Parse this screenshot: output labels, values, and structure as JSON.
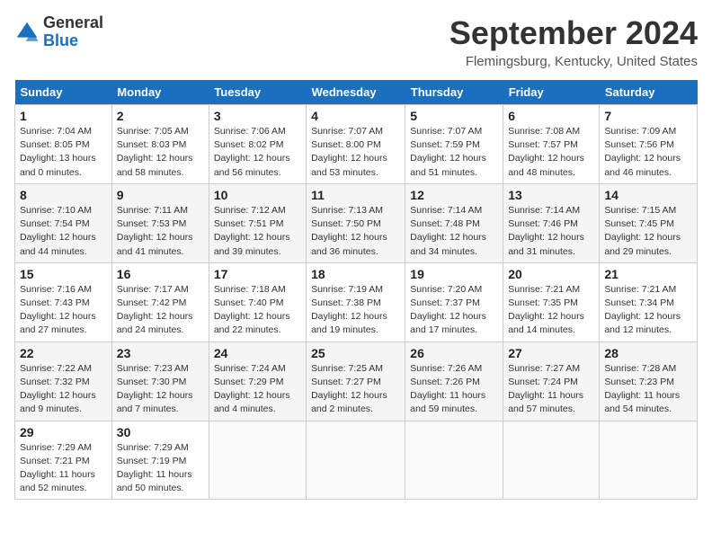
{
  "header": {
    "logo_line1": "General",
    "logo_line2": "Blue",
    "month_title": "September 2024",
    "location": "Flemingsburg, Kentucky, United States"
  },
  "calendar": {
    "days_of_week": [
      "Sunday",
      "Monday",
      "Tuesday",
      "Wednesday",
      "Thursday",
      "Friday",
      "Saturday"
    ],
    "weeks": [
      [
        {
          "num": "",
          "info": ""
        },
        {
          "num": "2",
          "info": "Sunrise: 7:05 AM\nSunset: 8:03 PM\nDaylight: 12 hours\nand 58 minutes."
        },
        {
          "num": "3",
          "info": "Sunrise: 7:06 AM\nSunset: 8:02 PM\nDaylight: 12 hours\nand 56 minutes."
        },
        {
          "num": "4",
          "info": "Sunrise: 7:07 AM\nSunset: 8:00 PM\nDaylight: 12 hours\nand 53 minutes."
        },
        {
          "num": "5",
          "info": "Sunrise: 7:07 AM\nSunset: 7:59 PM\nDaylight: 12 hours\nand 51 minutes."
        },
        {
          "num": "6",
          "info": "Sunrise: 7:08 AM\nSunset: 7:57 PM\nDaylight: 12 hours\nand 48 minutes."
        },
        {
          "num": "7",
          "info": "Sunrise: 7:09 AM\nSunset: 7:56 PM\nDaylight: 12 hours\nand 46 minutes."
        }
      ],
      [
        {
          "num": "1",
          "info": "Sunrise: 7:04 AM\nSunset: 8:05 PM\nDaylight: 13 hours\nand 0 minutes."
        },
        {
          "num": "8",
          "info": "Sunrise: 7:10 AM\nSunset: 7:54 PM\nDaylight: 12 hours\nand 44 minutes."
        },
        {
          "num": "9",
          "info": "Sunrise: 7:11 AM\nSunset: 7:53 PM\nDaylight: 12 hours\nand 41 minutes."
        },
        {
          "num": "10",
          "info": "Sunrise: 7:12 AM\nSunset: 7:51 PM\nDaylight: 12 hours\nand 39 minutes."
        },
        {
          "num": "11",
          "info": "Sunrise: 7:13 AM\nSunset: 7:50 PM\nDaylight: 12 hours\nand 36 minutes."
        },
        {
          "num": "12",
          "info": "Sunrise: 7:14 AM\nSunset: 7:48 PM\nDaylight: 12 hours\nand 34 minutes."
        },
        {
          "num": "13",
          "info": "Sunrise: 7:14 AM\nSunset: 7:46 PM\nDaylight: 12 hours\nand 31 minutes."
        },
        {
          "num": "14",
          "info": "Sunrise: 7:15 AM\nSunset: 7:45 PM\nDaylight: 12 hours\nand 29 minutes."
        }
      ],
      [
        {
          "num": "15",
          "info": "Sunrise: 7:16 AM\nSunset: 7:43 PM\nDaylight: 12 hours\nand 27 minutes."
        },
        {
          "num": "16",
          "info": "Sunrise: 7:17 AM\nSunset: 7:42 PM\nDaylight: 12 hours\nand 24 minutes."
        },
        {
          "num": "17",
          "info": "Sunrise: 7:18 AM\nSunset: 7:40 PM\nDaylight: 12 hours\nand 22 minutes."
        },
        {
          "num": "18",
          "info": "Sunrise: 7:19 AM\nSunset: 7:38 PM\nDaylight: 12 hours\nand 19 minutes."
        },
        {
          "num": "19",
          "info": "Sunrise: 7:20 AM\nSunset: 7:37 PM\nDaylight: 12 hours\nand 17 minutes."
        },
        {
          "num": "20",
          "info": "Sunrise: 7:21 AM\nSunset: 7:35 PM\nDaylight: 12 hours\nand 14 minutes."
        },
        {
          "num": "21",
          "info": "Sunrise: 7:21 AM\nSunset: 7:34 PM\nDaylight: 12 hours\nand 12 minutes."
        }
      ],
      [
        {
          "num": "22",
          "info": "Sunrise: 7:22 AM\nSunset: 7:32 PM\nDaylight: 12 hours\nand 9 minutes."
        },
        {
          "num": "23",
          "info": "Sunrise: 7:23 AM\nSunset: 7:30 PM\nDaylight: 12 hours\nand 7 minutes."
        },
        {
          "num": "24",
          "info": "Sunrise: 7:24 AM\nSunset: 7:29 PM\nDaylight: 12 hours\nand 4 minutes."
        },
        {
          "num": "25",
          "info": "Sunrise: 7:25 AM\nSunset: 7:27 PM\nDaylight: 12 hours\nand 2 minutes."
        },
        {
          "num": "26",
          "info": "Sunrise: 7:26 AM\nSunset: 7:26 PM\nDaylight: 11 hours\nand 59 minutes."
        },
        {
          "num": "27",
          "info": "Sunrise: 7:27 AM\nSunset: 7:24 PM\nDaylight: 11 hours\nand 57 minutes."
        },
        {
          "num": "28",
          "info": "Sunrise: 7:28 AM\nSunset: 7:23 PM\nDaylight: 11 hours\nand 54 minutes."
        }
      ],
      [
        {
          "num": "29",
          "info": "Sunrise: 7:29 AM\nSunset: 7:21 PM\nDaylight: 11 hours\nand 52 minutes."
        },
        {
          "num": "30",
          "info": "Sunrise: 7:29 AM\nSunset: 7:19 PM\nDaylight: 11 hours\nand 50 minutes."
        },
        {
          "num": "",
          "info": ""
        },
        {
          "num": "",
          "info": ""
        },
        {
          "num": "",
          "info": ""
        },
        {
          "num": "",
          "info": ""
        },
        {
          "num": "",
          "info": ""
        }
      ]
    ]
  }
}
